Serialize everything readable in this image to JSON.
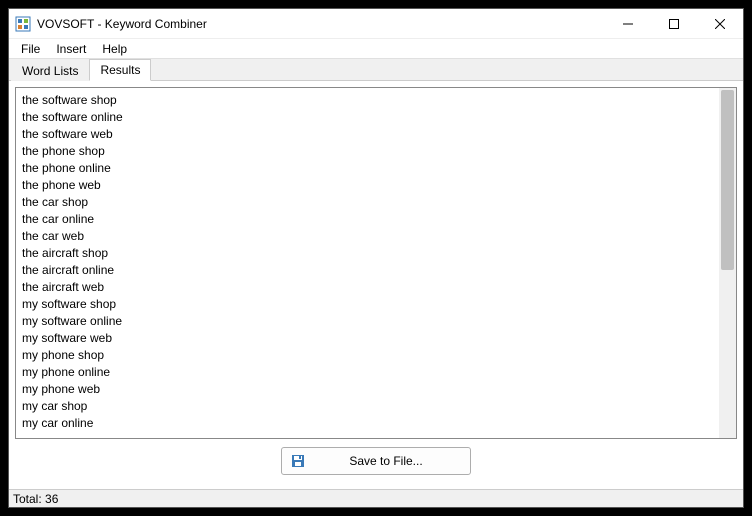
{
  "window": {
    "title": "VOVSOFT - Keyword Combiner"
  },
  "menu": {
    "file": "File",
    "insert": "Insert",
    "help": "Help"
  },
  "tabs": {
    "word_lists": "Word Lists",
    "results": "Results"
  },
  "results": [
    "the software shop",
    "the software online",
    "the software web",
    "the phone shop",
    "the phone online",
    "the phone web",
    "the car shop",
    "the car online",
    "the car web",
    "the aircraft shop",
    "the aircraft online",
    "the aircraft web",
    "my software shop",
    "my software online",
    "my software web",
    "my phone shop",
    "my phone online",
    "my phone web",
    "my car shop",
    "my car online"
  ],
  "buttons": {
    "save_to_file": "Save to File..."
  },
  "status": {
    "total": "Total: 36"
  }
}
